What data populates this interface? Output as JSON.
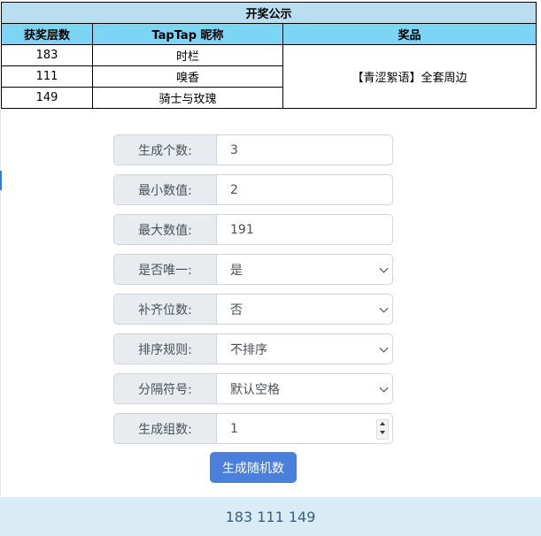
{
  "announcement": {
    "title": "开奖公示",
    "headers": [
      "获奖层数",
      "TapTap 昵称",
      "奖品"
    ],
    "rows": [
      {
        "floor": "183",
        "nickname": "时栏"
      },
      {
        "floor": "111",
        "nickname": "嗅香"
      },
      {
        "floor": "149",
        "nickname": "骑士与玫瑰"
      }
    ],
    "prize": "【青涩絮语】全套周边"
  },
  "form": {
    "count_label": "生成个数:",
    "count_value": "3",
    "min_label": "最小数值:",
    "min_value": "2",
    "max_label": "最大数值:",
    "max_value": "191",
    "unique_label": "是否唯一:",
    "unique_value": "是",
    "pad_label": "补齐位数:",
    "pad_value": "否",
    "sort_label": "排序规则:",
    "sort_value": "不排序",
    "sep_label": "分隔符号:",
    "sep_value": "默认空格",
    "groups_label": "生成组数:",
    "groups_value": "1"
  },
  "button": {
    "generate_label": "生成随机数"
  },
  "result": {
    "text": "183 111 149"
  }
}
